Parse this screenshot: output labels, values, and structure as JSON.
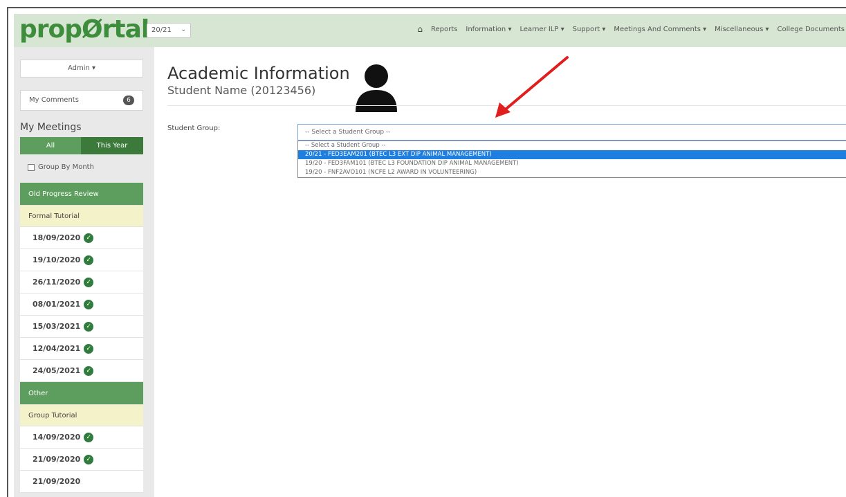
{
  "navbar": {
    "logo": "propØrtal",
    "year": "20/21",
    "items": [
      "Reports",
      "Information ▾",
      "Learner ILP ▾",
      "Support ▾",
      "Meetings And Comments ▾",
      "Miscellaneous ▾",
      "College Documents"
    ]
  },
  "sidebar": {
    "admin": "Admin ▾",
    "comments_label": "My Comments",
    "comments_count": "6",
    "meetings_title": "My Meetings",
    "tabs": {
      "all": "All",
      "this_year": "This Year"
    },
    "group_by_month": "Group By Month",
    "sections": [
      {
        "header": "Old Progress Review",
        "sub": "Formal Tutorial",
        "dates": [
          "18/09/2020",
          "19/10/2020",
          "26/11/2020",
          "08/01/2021",
          "15/03/2021",
          "12/04/2021",
          "24/05/2021"
        ]
      },
      {
        "header": "Other",
        "sub": "Group Tutorial",
        "dates": [
          "14/09/2020",
          "21/09/2020",
          "21/09/2020"
        ]
      }
    ]
  },
  "main": {
    "title": "Academic Information",
    "student": "Student Name (20123456)",
    "group_label": "Student Group:",
    "select_placeholder": "-- Select a Student Group --",
    "options": [
      "-- Select a Student Group --",
      "20/21 - FED3EAM201 (BTEC L3 EXT DIP ANIMAL MANAGEMENT)",
      "19/20 - FED3FAM101 (BTEC L3 FOUNDATION DIP ANIMAL MANAGEMENT)",
      "19/20 - FNF2AVO101 (NCFE L2 AWARD IN VOLUNTEERING)"
    ],
    "selected_option_index": 1
  },
  "colors": {
    "brand_green": "#3d8d3d",
    "nav_bg": "#d7e6d2",
    "sidebar_header": "#5d9d5d",
    "tutorial_bg": "#f4f2c9",
    "highlight": "#1e7fe0",
    "arrow": "#e01e1e"
  }
}
